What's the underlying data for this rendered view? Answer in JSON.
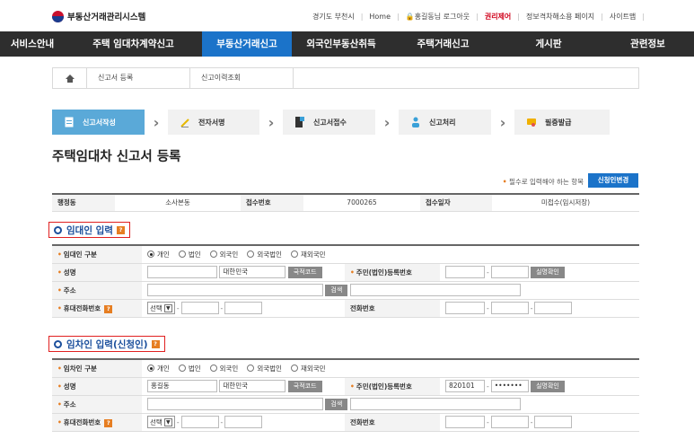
{
  "header": {
    "logo_text": "부동산거래관리시스템",
    "region": "경기도 부천시",
    "home": "Home",
    "user": "홍길동님 로그아웃",
    "auth": "권리제어",
    "accessibility": "정보격차해소용 페이지",
    "sitemap": "사이트맵"
  },
  "nav": [
    "서비스안내",
    "주택 임대차계약신고",
    "부동산거래신고",
    "외국인부동산취득",
    "주택거래신고",
    "게시판",
    "관련정보"
  ],
  "breadcrumb": [
    "신고서 등록",
    "신고이력조회"
  ],
  "steps": [
    "신고서작성",
    "전자서명",
    "신고서접수",
    "신고처리",
    "필증발급"
  ],
  "page_title": "주택임대차 신고서 등록",
  "required_note": "필수로 입력해야 하는 항목",
  "change_applicant_button": "신청인변경",
  "info_row": {
    "admin_label": "행정동",
    "admin_value": "소사본동",
    "receipt_no_label": "접수번호",
    "receipt_no_value": "7000265",
    "receipt_date_label": "접수일자",
    "receipt_date_value": "미접수(임시저장)"
  },
  "lessor": {
    "section_title": "임대인 입력",
    "type_label": "임대인 구분",
    "type_options": [
      "개인",
      "법인",
      "외국인",
      "외국법인",
      "재외국민"
    ],
    "name_label": "성명",
    "name_value": "",
    "country_value": "대한민국",
    "country_code_btn": "국적코드",
    "reg_no_label": "주민(법인)등록번호",
    "reg_no_1": "",
    "reg_no_2": "",
    "verify_btn": "실명확인",
    "address_label": "주소",
    "search_btn": "검색",
    "mobile_label": "휴대전화번호",
    "select_value": "선택",
    "phone_label": "전화번호"
  },
  "lessee": {
    "section_title": "임차인 입력(신청인)",
    "type_label": "임차인 구분",
    "type_options": [
      "개인",
      "법인",
      "외국인",
      "외국법인",
      "재외국민"
    ],
    "name_label": "성명",
    "name_value": "홍길동",
    "country_value": "대한민국",
    "country_code_btn": "국적코드",
    "reg_no_label": "주민(법인)등록번호",
    "reg_no_1": "820101",
    "reg_no_2": "•••••••",
    "verify_btn": "실명확인",
    "address_label": "주소",
    "search_btn": "검색",
    "mobile_label": "휴대전화번호",
    "select_value": "선택",
    "phone_label": "전화번호"
  },
  "help_badge": "?",
  "colors": {
    "nav_bg": "#2e2e2e",
    "nav_active": "#1b73c9",
    "step_active": "#5aa9d8",
    "section_border": "#e02020"
  }
}
